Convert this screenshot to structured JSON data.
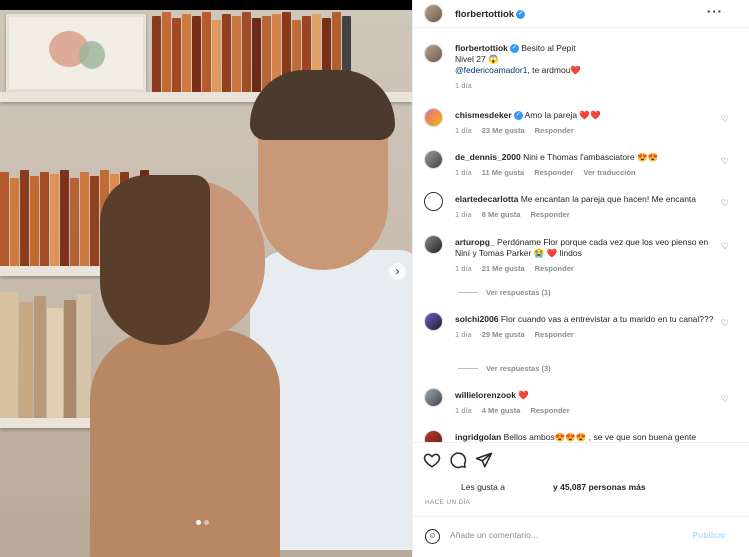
{
  "post": {
    "username": "florbertottiok",
    "caption_line1": "Besito al Pepit",
    "caption_line2": "Nivel 27 😱",
    "caption_mention": "@federicoamador1",
    "caption_tail": ", te ardmou❤️",
    "caption_time": "1 día"
  },
  "comments": [
    {
      "user": "chismesdeker",
      "text": "Amo la pareja ❤️❤️",
      "time": "1 día",
      "likes": "23 Me gusta",
      "action": "Responder",
      "translate": ""
    },
    {
      "user": "de_dennis_2000",
      "text": "Nini e Thomas l'ambasciatore 😍😍",
      "time": "1 día",
      "likes": "11 Me gusta",
      "action": "Responder",
      "translate": "Ver traducción"
    },
    {
      "user": "elartedecarlotta",
      "text": "Me encantan la pareja que hacen! Me encanta",
      "time": "1 día",
      "likes": "8 Me gusta",
      "action": "Responder",
      "translate": ""
    },
    {
      "user": "arturopg_",
      "text": "Perdóname Flor porque cada vez que los veo pienso en Niní y Tomas Parker 😭 ❤️ lindos",
      "time": "1 día",
      "likes": "21 Me gusta",
      "action": "Responder",
      "translate": "",
      "replies": "Ver respuestas (1)"
    },
    {
      "user": "solchi2006",
      "text": "Flor cuando vas a entrevistar a tu marido en tu canal???",
      "time": "1 día",
      "likes": "29 Me gusta",
      "action": "Responder",
      "translate": "",
      "replies": "Ver respuestas (3)"
    },
    {
      "user": "willielorenzook",
      "text": "❤️",
      "time": "1 día",
      "likes": "4 Me gusta",
      "action": "Responder",
      "translate": ""
    },
    {
      "user": "ingridgolan",
      "text": "Bellos ambos😍😍😍 , se ve que son buena gente",
      "time": "",
      "likes": "",
      "action": "",
      "translate": ""
    }
  ],
  "footer": {
    "likes_prefix": "Les gusta a",
    "likes_rest": "y 45,087 personas más",
    "time": "HACE UN DÍA",
    "add_placeholder": "Añade un comentario...",
    "publish": "Publicar"
  },
  "icons": {
    "more": "more-options-icon",
    "heart": "heart-icon",
    "comment": "comment-icon",
    "share": "share-icon",
    "emoji": "emoji-icon"
  }
}
